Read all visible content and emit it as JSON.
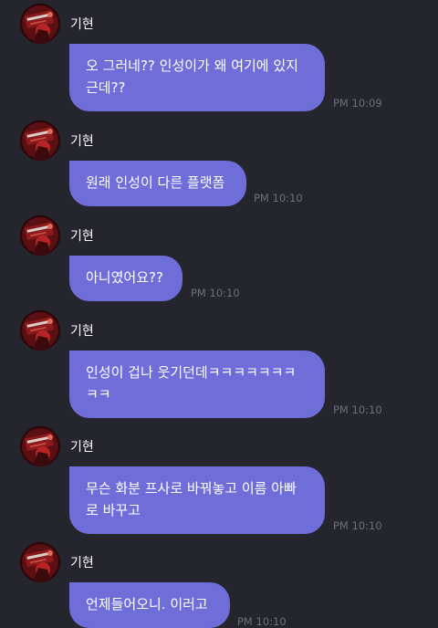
{
  "messages": [
    {
      "sender": "기현",
      "text": "오 그러네?? 인성이가 왜 여기에 있지\n근데??",
      "time": "PM 10:09"
    },
    {
      "sender": "기현",
      "text": "원래 인성이 다른 플랫폼",
      "time": "PM 10:10"
    },
    {
      "sender": "기현",
      "text": "아니였어요??",
      "time": "PM 10:10"
    },
    {
      "sender": "기현",
      "text": "인성이 겁나 웃기던데ㅋㅋㅋㅋㅋㅋㅋ\nㅋㅋ",
      "time": "PM 10:10"
    },
    {
      "sender": "기현",
      "text": "무슨 화분 프사로 바꿔놓고 이름 아빠\n로 바꾸고",
      "time": "PM 10:10"
    },
    {
      "sender": "기현",
      "text": "언제들어오니. 이러고",
      "time": "PM 10:10"
    }
  ],
  "colors": {
    "background": "#25252d",
    "bubble": "#6f6dd8",
    "bubble_text": "#ffffff",
    "sender_text": "#ffffff",
    "timestamp": "#6e6e78"
  },
  "icons": {
    "avatar": "profile-photo-avatar"
  }
}
